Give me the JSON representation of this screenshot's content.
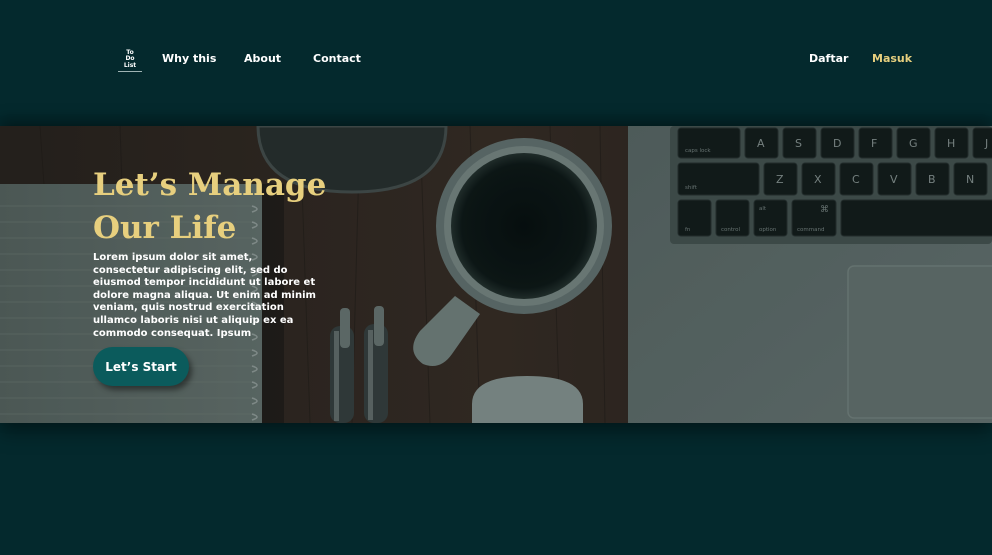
{
  "brand": {
    "logo_lines": [
      "To",
      "Do",
      "List"
    ]
  },
  "nav": {
    "links": [
      "Why this",
      "About",
      "Contact"
    ],
    "register_label": "Daftar",
    "login_label": "Masuk"
  },
  "hero": {
    "title_line1": "Let’s Manage",
    "title_line2": "Our Life",
    "description": "Lorem ipsum dolor sit amet, consectetur adipiscing elit, sed do eiusmod tempor incididunt ut labore et dolore magna aliqua. Ut enim ad minim veniam, quis nostrud exercitation ullamco laboris nisi ut aliquip ex ea commodo consequat. Ipsum",
    "cta_label": "Let’s Start",
    "keyboard_keys": [
      "A",
      "S",
      "D",
      "F",
      "G",
      "H",
      "J",
      "Z",
      "X",
      "C",
      "V",
      "B",
      "N"
    ],
    "keyboard_small_labels": [
      "caps lock",
      "shift",
      "fn",
      "control",
      "option",
      "command",
      "alt",
      "⌘"
    ]
  },
  "colors": {
    "background": "#04292d",
    "accent_gold": "#e7cf7e",
    "button_teal": "#0b5b5c"
  }
}
